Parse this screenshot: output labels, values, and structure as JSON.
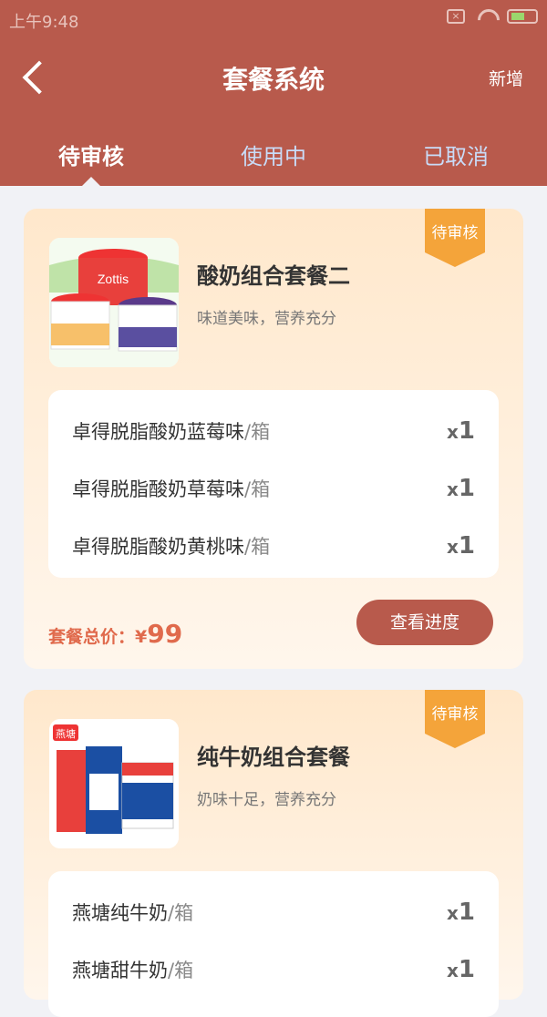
{
  "status": {
    "time": "上午9:48"
  },
  "nav": {
    "title": "套餐系统",
    "add_label": "新增"
  },
  "tabs": [
    {
      "label": "待审核"
    },
    {
      "label": "使用中"
    },
    {
      "label": "已取消"
    }
  ],
  "cards": [
    {
      "badge": "待审核",
      "name": "酸奶组合套餐二",
      "desc": "味道美味，营养充分",
      "items": [
        {
          "name": "卓得脱脂酸奶蓝莓味",
          "unit": "/箱",
          "qty_prefix": "x",
          "qty": "1"
        },
        {
          "name": "卓得脱脂酸奶草莓味",
          "unit": "/箱",
          "qty_prefix": "x",
          "qty": "1"
        },
        {
          "name": "卓得脱脂酸奶黄桃味",
          "unit": "/箱",
          "qty_prefix": "x",
          "qty": "1"
        }
      ],
      "price_label": "套餐总价：¥",
      "price": "99",
      "button_label": "查看进度"
    },
    {
      "badge": "待审核",
      "name": "纯牛奶组合套餐",
      "desc": "奶味十足，营养充分",
      "items": [
        {
          "name": "燕塘纯牛奶",
          "unit": "/箱",
          "qty_prefix": "x",
          "qty": "1"
        },
        {
          "name": "燕塘甜牛奶",
          "unit": "/箱",
          "qty_prefix": "x",
          "qty": "1"
        }
      ]
    }
  ],
  "product_images": [
    {
      "brand_text": "Zottis"
    },
    {
      "brand_text": "燕塘"
    }
  ],
  "colors": {
    "header": "#b85a4c",
    "badge": "#f4a43a",
    "price": "#e06a4c"
  }
}
